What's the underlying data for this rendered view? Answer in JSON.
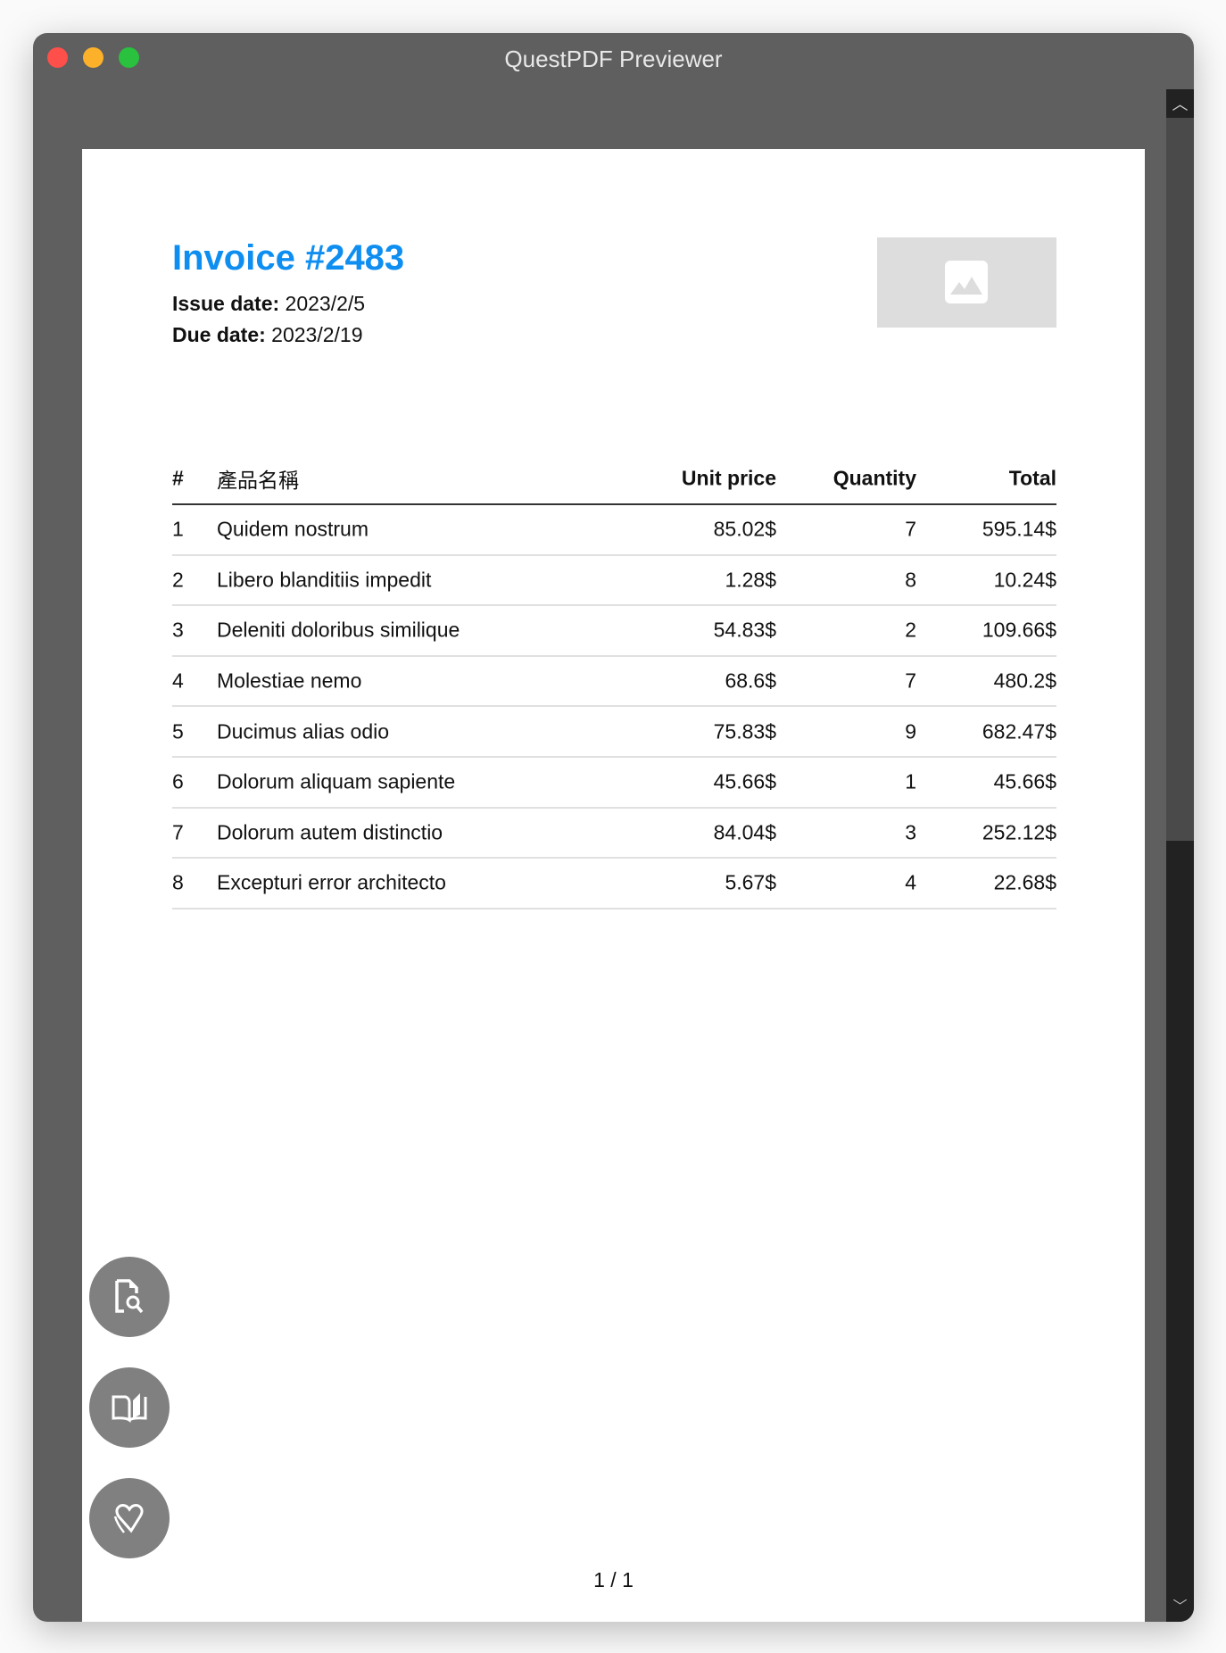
{
  "window": {
    "title": "QuestPDF Previewer"
  },
  "invoice": {
    "title": "Invoice #2483",
    "issue_label": "Issue date:",
    "issue_value": " 2023/2/5",
    "due_label": "Due date:",
    "due_value": " 2023/2/19"
  },
  "table": {
    "headers": [
      "#",
      "產品名稱",
      "Unit price",
      "Quantity",
      "Total"
    ],
    "rows": [
      [
        "1",
        "Quidem nostrum",
        "85.02$",
        "7",
        "595.14$"
      ],
      [
        "2",
        "Libero blanditiis impedit",
        "1.28$",
        "8",
        "10.24$"
      ],
      [
        "3",
        "Deleniti doloribus similique",
        "54.83$",
        "2",
        "109.66$"
      ],
      [
        "4",
        "Molestiae nemo",
        "68.6$",
        "7",
        "480.2$"
      ],
      [
        "5",
        "Ducimus alias odio",
        "75.83$",
        "9",
        "682.47$"
      ],
      [
        "6",
        "Dolorum aliquam sapiente",
        "45.66$",
        "1",
        "45.66$"
      ],
      [
        "7",
        "Dolorum autem distinctio",
        "84.04$",
        "3",
        "252.12$"
      ],
      [
        "8",
        "Excepturi error architecto",
        "5.67$",
        "4",
        "22.68$"
      ]
    ]
  },
  "page_number": "1 / 1",
  "colors": {
    "accent": "#0e8ef0",
    "close": "#fe4f4a",
    "minimize": "#fdb12a",
    "zoom": "#29c13e"
  }
}
